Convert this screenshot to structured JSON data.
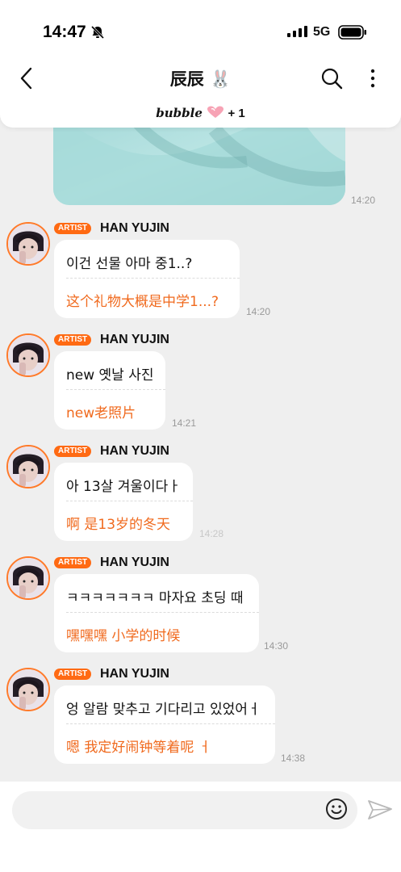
{
  "status_bar": {
    "time": "14:47",
    "network": "5G"
  },
  "header": {
    "title": "辰辰",
    "title_emoji": "🐰",
    "subtitle_brand": "bubble",
    "subtitle_suffix": "+ 1"
  },
  "photo_message": {
    "time": "14:20"
  },
  "messages": [
    {
      "badge": "ARTIST",
      "sender": "HAN YUJIN",
      "text": "이건 선물 아마 중1..?",
      "translation": "这个礼物大概是中学1...?",
      "time": "14:20"
    },
    {
      "badge": "ARTIST",
      "sender": "HAN YUJIN",
      "text": "new 옛날 사진",
      "translation": "new老照片",
      "time": "14:21"
    },
    {
      "badge": "ARTIST",
      "sender": "HAN YUJIN",
      "text": "아 13살 겨울이다ㅏ",
      "translation": "啊 是13岁的冬天",
      "time": "14:28"
    },
    {
      "badge": "ARTIST",
      "sender": "HAN YUJIN",
      "text": "ㅋㅋㅋㅋㅋㅋㅋ 마자요 초딩 때",
      "translation": "嘿嘿嘿 小学的时候",
      "time": "14:30"
    },
    {
      "badge": "ARTIST",
      "sender": "HAN YUJIN",
      "text": "엉 알람 맞추고 기다리고 있었어ㅓ",
      "translation": "嗯 我定好闹钟等着呢 ㅓ",
      "time": "14:38"
    }
  ],
  "colors": {
    "accent": "#ff6a13",
    "translation": "#f06a1e",
    "background": "#efefef"
  },
  "icons": {
    "back": "back-arrow-icon",
    "search": "search-icon",
    "more": "more-vertical-icon",
    "emoji": "smile-icon",
    "send": "send-icon"
  }
}
